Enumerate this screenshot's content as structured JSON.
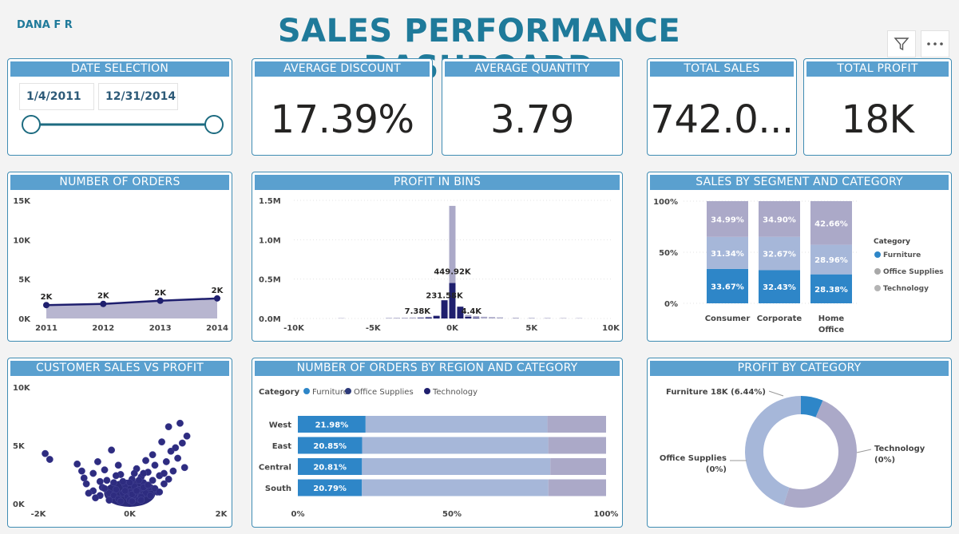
{
  "header": {
    "author": "DANA F R",
    "title": "SALES PERFORMANCE DASHBOARD"
  },
  "date_selection": {
    "title": "DATE SELECTION",
    "start": "1/4/2011",
    "end": "12/31/2014",
    "range": [
      0,
      1
    ]
  },
  "kpis": {
    "avg_discount": {
      "title": "AVERAGE DISCOUNT",
      "value": "17.39%"
    },
    "avg_quantity": {
      "title": "AVERAGE QUANTITY",
      "value": "3.79"
    },
    "total_sales": {
      "title": "TOTAL SALES",
      "value": "742.0..."
    },
    "total_profit": {
      "title": "TOTAL PROFIT",
      "value": "18K"
    }
  },
  "colors": {
    "accent": "#1f7a9a",
    "title_bar": "#5aa0cf",
    "furniture": "#2e86c8",
    "office": "#a6b7d9",
    "technology": "#aba9c8",
    "navy": "#1f1f6e",
    "area": "#aba9c8"
  },
  "chart_data": [
    {
      "id": "orders",
      "title": "NUMBER OF ORDERS",
      "type": "area",
      "x": [
        "2011",
        "2012",
        "2013",
        "2014"
      ],
      "values": [
        1700,
        1850,
        2250,
        2550
      ],
      "data_labels": [
        "2K",
        "2K",
        "2K",
        "2K"
      ],
      "yticks": [
        {
          "v": 0,
          "t": "0K"
        },
        {
          "v": 5000,
          "t": "5K"
        },
        {
          "v": 10000,
          "t": "10K"
        },
        {
          "v": 15000,
          "t": "15K"
        }
      ],
      "ylim": [
        0,
        15000
      ]
    },
    {
      "id": "bins",
      "title": "PROFIT IN BINS",
      "type": "bar",
      "xlim": [
        -10000,
        10000
      ],
      "ylim": [
        0,
        1500000
      ],
      "xticks": [
        {
          "v": -10000,
          "t": "-10K"
        },
        {
          "v": -5000,
          "t": "-5K"
        },
        {
          "v": 0,
          "t": "0K"
        },
        {
          "v": 5000,
          "t": "5K"
        },
        {
          "v": 10000,
          "t": "10K"
        }
      ],
      "yticks": [
        {
          "v": 0,
          "t": "0.0M"
        },
        {
          "v": 500000,
          "t": "0.5M"
        },
        {
          "v": 1000000,
          "t": "1.0M"
        },
        {
          "v": 1500000,
          "t": "1.5M"
        }
      ],
      "series": [
        {
          "name": "light",
          "bins": [
            {
              "x": -4000,
              "v": 8000
            },
            {
              "x": -3500,
              "v": 9000
            },
            {
              "x": -3000,
              "v": 10000
            },
            {
              "x": -2500,
              "v": 12000
            },
            {
              "x": -2000,
              "v": 15000
            },
            {
              "x": -1500,
              "v": 22000
            },
            {
              "x": -1000,
              "v": 40000
            },
            {
              "x": -500,
              "v": 80000
            },
            {
              "x": 0,
              "v": 1430000
            },
            {
              "x": 500,
              "v": 90000
            },
            {
              "x": 1000,
              "v": 45000
            },
            {
              "x": 1500,
              "v": 30000
            },
            {
              "x": 2000,
              "v": 22000
            },
            {
              "x": 2500,
              "v": 18000
            },
            {
              "x": 3000,
              "v": 14000
            },
            {
              "x": 4000,
              "v": 10000
            },
            {
              "x": 5000,
              "v": 8000
            },
            {
              "x": 6000,
              "v": 7000
            },
            {
              "x": 7000,
              "v": 6000
            },
            {
              "x": 8000,
              "v": 5000
            },
            {
              "x": -7000,
              "v": 5000
            }
          ]
        },
        {
          "name": "dark",
          "bins": [
            {
              "x": -2000,
              "v": 5000
            },
            {
              "x": -1500,
              "v": 12000
            },
            {
              "x": -1000,
              "v": 30000
            },
            {
              "x": -500,
              "v": 231580
            },
            {
              "x": 0,
              "v": 449920
            },
            {
              "x": 500,
              "v": 150000
            },
            {
              "x": 1000,
              "v": 20000
            },
            {
              "x": 1500,
              "v": 8000
            }
          ]
        }
      ],
      "labels": [
        {
          "x": -500,
          "v": 260000,
          "t": "231.58K"
        },
        {
          "x": 0,
          "v": 560000,
          "t": "449.92K"
        },
        {
          "x": -2200,
          "v": 60000,
          "t": "7.38K"
        },
        {
          "x": 1200,
          "v": 60000,
          "t": "4.4K"
        }
      ]
    },
    {
      "id": "segment",
      "title": "SALES BY SEGMENT AND CATEGORY",
      "type": "bar",
      "stacked": "100%",
      "categories": [
        "Consumer",
        "Corporate",
        "Home Office"
      ],
      "category_lines": [
        [
          "Consumer"
        ],
        [
          "Corporate"
        ],
        [
          "Home",
          "Office"
        ]
      ],
      "series": [
        {
          "name": "Furniture",
          "values": [
            33.67,
            32.43,
            28.38
          ],
          "labels": [
            "33.67%",
            "32.43%",
            "28.38%"
          ]
        },
        {
          "name": "Office Supplies",
          "values": [
            31.34,
            32.67,
            28.96
          ],
          "labels": [
            "31.34%",
            "32.67%",
            "28.96%"
          ]
        },
        {
          "name": "Technology",
          "values": [
            34.99,
            34.9,
            42.66
          ],
          "labels": [
            "34.99%",
            "34.90%",
            "42.66%"
          ]
        }
      ],
      "yticks": [
        {
          "v": 0,
          "t": "0%"
        },
        {
          "v": 50,
          "t": "50%"
        },
        {
          "v": 100,
          "t": "100%"
        }
      ],
      "legend_title": "Category",
      "legend": [
        "Furniture",
        "Office Supplies",
        "Technology"
      ]
    },
    {
      "id": "scatter",
      "title": "CUSTOMER SALES VS PROFIT",
      "type": "scatter",
      "xlim": [
        -2000,
        2000
      ],
      "ylim": [
        0,
        10000
      ],
      "xticks": [
        {
          "v": -2000,
          "t": "-2K"
        },
        {
          "v": 0,
          "t": "0K"
        },
        {
          "v": 2000,
          "t": "2K"
        }
      ],
      "yticks": [
        {
          "v": 0,
          "t": "0K"
        },
        {
          "v": 5000,
          "t": "5K"
        },
        {
          "v": 10000,
          "t": "10K"
        }
      ],
      "points": [
        [
          -1850,
          4300
        ],
        [
          -1750,
          3800
        ],
        [
          -1150,
          3400
        ],
        [
          -1050,
          2800
        ],
        [
          -1000,
          2200
        ],
        [
          -950,
          1700
        ],
        [
          -800,
          1100
        ],
        [
          -650,
          700
        ],
        [
          -600,
          1400
        ],
        [
          -550,
          2900
        ],
        [
          -500,
          2000
        ],
        [
          -400,
          4600
        ],
        [
          -350,
          1800
        ],
        [
          -300,
          1200
        ],
        [
          -250,
          3300
        ],
        [
          -200,
          2500
        ],
        [
          -150,
          900
        ],
        [
          -100,
          1600
        ],
        [
          -50,
          600
        ],
        [
          0,
          300
        ],
        [
          0,
          1000
        ],
        [
          50,
          2100
        ],
        [
          100,
          700
        ],
        [
          100,
          1500
        ],
        [
          150,
          3000
        ],
        [
          200,
          1200
        ],
        [
          200,
          400
        ],
        [
          250,
          2300
        ],
        [
          300,
          1800
        ],
        [
          350,
          900
        ],
        [
          350,
          3700
        ],
        [
          400,
          2700
        ],
        [
          450,
          1400
        ],
        [
          500,
          2000
        ],
        [
          500,
          4200
        ],
        [
          550,
          3300
        ],
        [
          600,
          1000
        ],
        [
          650,
          2400
        ],
        [
          700,
          5300
        ],
        [
          750,
          1700
        ],
        [
          800,
          3600
        ],
        [
          850,
          6600
        ],
        [
          900,
          4500
        ],
        [
          950,
          2800
        ],
        [
          1000,
          4800
        ],
        [
          1050,
          3900
        ],
        [
          1100,
          6900
        ],
        [
          1150,
          5200
        ],
        [
          1200,
          3100
        ],
        [
          1250,
          5800
        ],
        [
          -700,
          3600
        ],
        [
          -450,
          900
        ],
        [
          -300,
          2400
        ],
        [
          -150,
          1900
        ],
        [
          50,
          800
        ],
        [
          150,
          1100
        ],
        [
          250,
          600
        ],
        [
          300,
          1400
        ],
        [
          -800,
          2600
        ],
        [
          -650,
          1900
        ],
        [
          -550,
          1300
        ],
        [
          -350,
          700
        ],
        [
          -250,
          400
        ],
        [
          -100,
          1100
        ],
        [
          0,
          1800
        ],
        [
          100,
          2600
        ],
        [
          200,
          2000
        ],
        [
          300,
          2600
        ],
        [
          400,
          1600
        ],
        [
          450,
          700
        ],
        [
          550,
          1300
        ],
        [
          650,
          1000
        ],
        [
          750,
          2600
        ],
        [
          850,
          2100
        ],
        [
          -900,
          900
        ],
        [
          -750,
          500
        ],
        [
          -450,
          300
        ],
        [
          -200,
          200
        ],
        [
          50,
          200
        ],
        [
          250,
          300
        ]
      ],
      "cloud_rx": 330,
      "cloud_ry": 900
    },
    {
      "id": "region",
      "title": "NUMBER OF ORDERS BY REGION AND CATEGORY",
      "type": "bar",
      "orientation": "horizontal",
      "stacked": "100%",
      "legend_title": "Category",
      "legend": [
        "Furniture",
        "Office Supplies",
        "Technology"
      ],
      "categories": [
        "West",
        "East",
        "Central",
        "South"
      ],
      "series": [
        {
          "name": "Furniture",
          "values": [
            21.98,
            20.85,
            20.81,
            20.79
          ],
          "labels": [
            "21.98%",
            "20.85%",
            "20.81%",
            "20.79%"
          ]
        },
        {
          "name": "Office Supplies",
          "values": [
            59.0,
            60.4,
            61.1,
            60.5
          ]
        },
        {
          "name": "Technology",
          "values": [
            19.02,
            18.75,
            18.09,
            18.71
          ]
        }
      ],
      "xticks": [
        {
          "v": 0,
          "t": "0%"
        },
        {
          "v": 50,
          "t": "50%"
        },
        {
          "v": 100,
          "t": "100%"
        }
      ]
    },
    {
      "id": "donut",
      "title": "PROFIT BY CATEGORY",
      "type": "pie",
      "labels": [
        "Furniture",
        "Office Supplies",
        "Technology"
      ],
      "values": [
        6.44,
        45.0,
        48.56
      ],
      "label_text": [
        "Furniture 18K (6.44%)",
        "Office Supplies",
        "(0%)",
        "Technology",
        "(0%)"
      ]
    }
  ]
}
